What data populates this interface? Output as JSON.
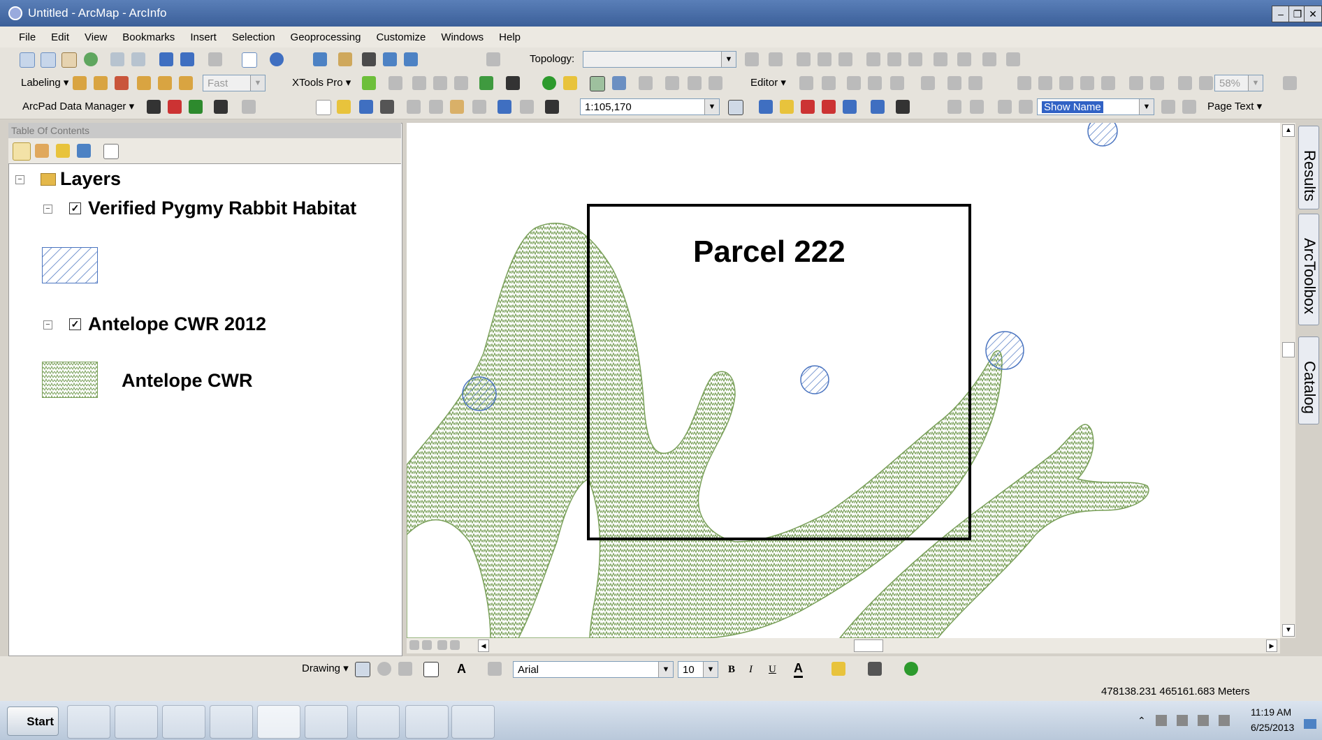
{
  "window": {
    "title": "Untitled - ArcMap - ArcInfo"
  },
  "menu": [
    "File",
    "Edit",
    "View",
    "Bookmarks",
    "Insert",
    "Selection",
    "Geoprocessing",
    "Customize",
    "Windows",
    "Help"
  ],
  "toolbar1": {
    "topology_label": "Topology:"
  },
  "toolbar2": {
    "labeling": "Labeling",
    "fast": "Fast",
    "xtools": "XTools Pro",
    "editor": "Editor",
    "zoom_pct": "58%"
  },
  "toolbar3": {
    "arcpad": "ArcPad Data Manager",
    "scale": "1:105,170",
    "show_name": "Show Name",
    "page_text": "Page Text"
  },
  "toc": {
    "title": "Table Of Contents",
    "root": "Layers",
    "layers": [
      {
        "name": "Verified Pygmy Rabbit Habitat",
        "checked": true,
        "legend_label": ""
      },
      {
        "name": "Antelope CWR 2012",
        "checked": true,
        "legend_label": "Antelope CWR"
      }
    ]
  },
  "map": {
    "parcel_label": "Parcel 222",
    "colors": {
      "habitat": "#7aa05a",
      "rabbit": "#4a74c0"
    }
  },
  "dock": {
    "tabs": [
      "Results",
      "ArcToolbox",
      "Catalog"
    ]
  },
  "drawing": {
    "label": "Drawing",
    "font": "Arial",
    "size": "10"
  },
  "status": {
    "coords": "478138.231  465161.683 Meters"
  },
  "taskbar": {
    "start": "Start",
    "time": "11:19 AM",
    "date": "6/25/2013"
  }
}
